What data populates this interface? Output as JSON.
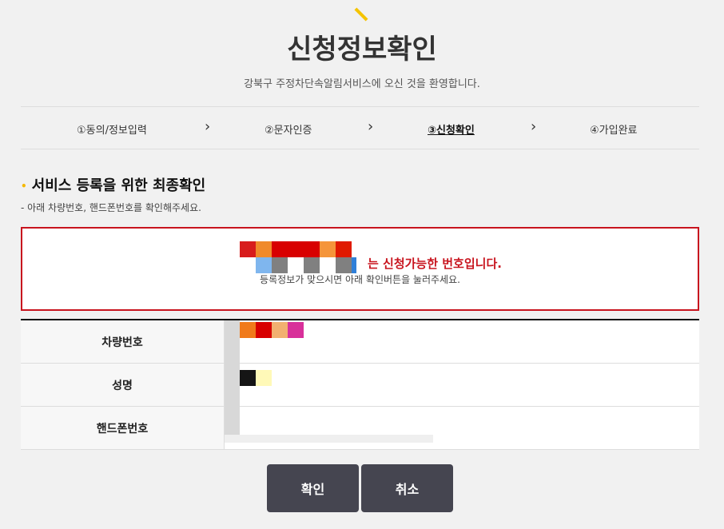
{
  "header": {
    "title": "신청정보확인",
    "subtitle": "강북구 주정차단속알림서비스에 오신 것을 환영합니다."
  },
  "steps": [
    {
      "label": "①동의/정보입력",
      "active": false
    },
    {
      "label": "②문자인증",
      "active": false
    },
    {
      "label": "③신청확인",
      "active": true
    },
    {
      "label": "④가입완료",
      "active": false
    }
  ],
  "step_separator": "›",
  "section": {
    "title": "서비스 등록을 위한 최종확인",
    "description": "- 아래 차량번호, 핸드폰번호를 확인해주세요."
  },
  "notice": {
    "available_text": "는 신청가능한 번호입니다.",
    "instruction": "등록정보가 맞으시면 아래 확인버튼을 눌러주세요."
  },
  "table": {
    "rows": [
      {
        "label": "차량번호"
      },
      {
        "label": "성명"
      },
      {
        "label": "핸드폰번호"
      }
    ]
  },
  "actions": {
    "confirm_label": "확인",
    "cancel_label": "취소"
  },
  "colors": {
    "accent": "#f5c400",
    "alert_red": "#c8141e",
    "button_bg": "#454550"
  }
}
